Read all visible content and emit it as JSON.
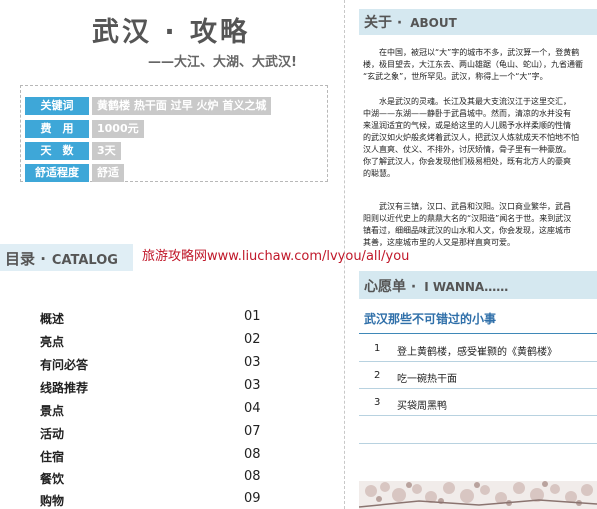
{
  "left": {
    "title": "武汉 · 攻略",
    "slogan": "——大江、大湖、大武汉!",
    "info": [
      {
        "label": "关键词",
        "value": "黄鹤楼 热干面 过早 火炉 首义之城"
      },
      {
        "label": "费　用",
        "value": "1000元"
      },
      {
        "label": "天　数",
        "value": "3天"
      },
      {
        "label": "舒适程度",
        "value": "舒适"
      }
    ],
    "toc": {
      "title_cn": "目录 ·",
      "title_en": "CATALOG",
      "items": [
        {
          "name": "概述",
          "page": "01"
        },
        {
          "name": "亮点",
          "page": "02"
        },
        {
          "name": "有问必答",
          "page": "03"
        },
        {
          "name": "线路推荐",
          "page": "03"
        },
        {
          "name": "景点",
          "page": "04"
        },
        {
          "name": "活动",
          "page": "07"
        },
        {
          "name": "住宿",
          "page": "08"
        },
        {
          "name": "餐饮",
          "page": "08"
        },
        {
          "name": "购物",
          "page": "09"
        }
      ]
    }
  },
  "watermark": "旅游攻略网www.liuchaw.com/lvyou/all/you",
  "right": {
    "about": {
      "title_cn": "关于 ·",
      "title_en": "ABOUT",
      "paragraphs": [
        [
          "　　在中国，被冠以“大”字的城市不多，武汉算一个，登黄鹤",
          "楼，极目望去，大江东去、两山雄踞（龟山、蛇山），九省通衢",
          "“玄武之象”，世所罕见。武汉，称得上一个“大”字。"
        ],
        [
          "　　水是武汉的灵魂。长江及其最大支流汉江于这里交汇，",
          "中湖——东湖——静卧于武昌城中。然而，清凉的水并没有",
          "来温润适宜的气候，或是给这里的人儿赐予水样柔顺的性情",
          "的武汉如火炉般炙烤着武汉人，把武汉人炼就成天不怕地不怕",
          "汉人直爽、仗义、不排外，讨厌矫情，骨子里有一种豪放。",
          "你了解武汉人，你会发现他们极易相处，既有北方人的豪爽",
          "的聪慧。"
        ],
        [
          "　　武汉有三镇，汉口、武昌和汉阳。汉口商业繁华，武昌",
          "阳则以近代史上的鼎鼎大名的“汉阳造”闻名于世。来到武汉",
          "镇看过，细细品味武汉的山水和人文，你会发现，这座城市",
          "其善，这座城市里的人又是那样直爽可爱。"
        ]
      ]
    },
    "wish": {
      "title_cn": "心愿单 ·",
      "title_en": "I WANNA……",
      "subtitle": "武汉那些不可错过的小事",
      "items": [
        {
          "num": "1",
          "text": "登上黄鹤楼，感受崔颢的《黄鹤楼》"
        },
        {
          "num": "2",
          "text": "吃一碗热干面"
        },
        {
          "num": "3",
          "text": "买袋周黑鸭"
        }
      ]
    }
  }
}
